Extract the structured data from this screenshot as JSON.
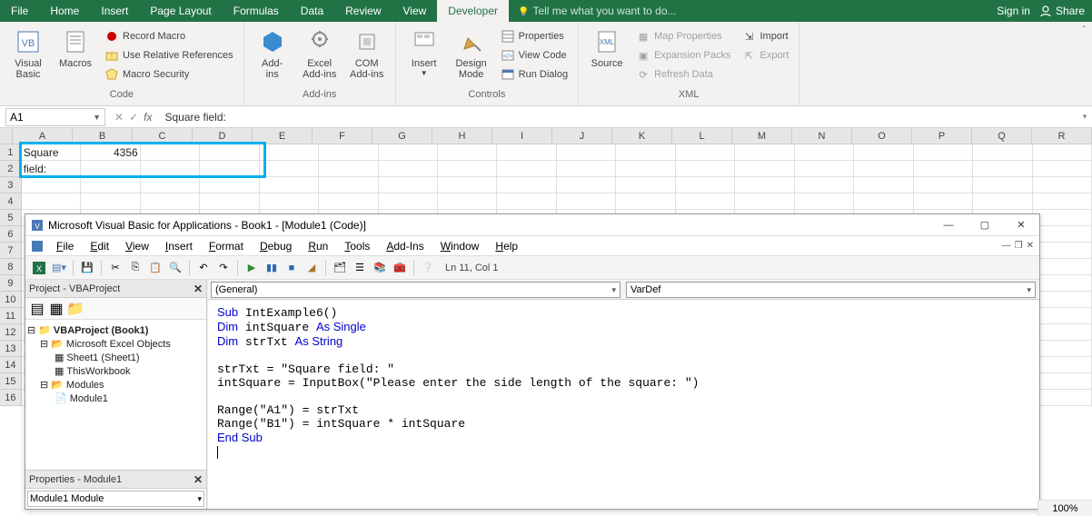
{
  "menubar": {
    "tabs": [
      "File",
      "Home",
      "Insert",
      "Page Layout",
      "Formulas",
      "Data",
      "Review",
      "View",
      "Developer"
    ],
    "active_index": 8,
    "tell_me": "Tell me what you want to do...",
    "sign_in": "Sign in",
    "share": "Share"
  },
  "ribbon": {
    "code": {
      "label": "Code",
      "visual_basic": "Visual\nBasic",
      "macros": "Macros",
      "record_macro": "Record Macro",
      "use_relative": "Use Relative References",
      "macro_security": "Macro Security"
    },
    "addins": {
      "label": "Add-ins",
      "addins": "Add-\nins",
      "excel_addins": "Excel\nAdd-ins",
      "com_addins": "COM\nAdd-ins"
    },
    "controls": {
      "label": "Controls",
      "insert": "Insert",
      "design_mode": "Design\nMode",
      "properties": "Properties",
      "view_code": "View Code",
      "run_dialog": "Run Dialog"
    },
    "xml": {
      "label": "XML",
      "source": "Source",
      "map_properties": "Map Properties",
      "expansion_packs": "Expansion Packs",
      "refresh_data": "Refresh Data",
      "import": "Import",
      "export": "Export"
    }
  },
  "name_box": "A1",
  "formula_bar": "Square field:",
  "columns": [
    "A",
    "B",
    "C",
    "D",
    "E",
    "F",
    "G",
    "H",
    "I",
    "J",
    "K",
    "L",
    "M",
    "N",
    "O",
    "P",
    "Q",
    "R"
  ],
  "rows_visible": [
    "1",
    "2",
    "3",
    "4",
    "5",
    "6",
    "7",
    "8",
    "9",
    "10",
    "11",
    "12",
    "13",
    "14",
    "15",
    "16"
  ],
  "cells": {
    "A1": "Square field:",
    "B1": "4356"
  },
  "vba": {
    "title": "Microsoft Visual Basic for Applications - Book1 - [Module1 (Code)]",
    "menus": [
      "File",
      "Edit",
      "View",
      "Insert",
      "Format",
      "Debug",
      "Run",
      "Tools",
      "Add-Ins",
      "Window",
      "Help"
    ],
    "cursor_pos": "Ln 11, Col 1",
    "project_panel_title": "Project - VBAProject",
    "tree": {
      "root": "VBAProject (Book1)",
      "excel_objects": "Microsoft Excel Objects",
      "sheet1": "Sheet1 (Sheet1)",
      "thisworkbook": "ThisWorkbook",
      "modules": "Modules",
      "module1": "Module1"
    },
    "props_panel_title": "Properties - Module1",
    "props_select": "Module1 Module",
    "dd_left": "(General)",
    "dd_right": "VarDef",
    "code_lines": [
      {
        "t": "plain",
        "tokens": [
          {
            "k": true,
            "s": "Sub"
          },
          {
            "k": false,
            "s": " IntExample6()"
          }
        ]
      },
      {
        "t": "plain",
        "tokens": [
          {
            "k": true,
            "s": "Dim"
          },
          {
            "k": false,
            "s": " intSquare "
          },
          {
            "k": true,
            "s": "As Single"
          }
        ]
      },
      {
        "t": "plain",
        "tokens": [
          {
            "k": true,
            "s": "Dim"
          },
          {
            "k": false,
            "s": " strTxt "
          },
          {
            "k": true,
            "s": "As String"
          }
        ]
      },
      {
        "t": "blank"
      },
      {
        "t": "plain",
        "tokens": [
          {
            "k": false,
            "s": "strTxt = \"Square field: \""
          }
        ]
      },
      {
        "t": "plain",
        "tokens": [
          {
            "k": false,
            "s": "intSquare = InputBox(\"Please enter the side length of the square: \")"
          }
        ]
      },
      {
        "t": "blank"
      },
      {
        "t": "plain",
        "tokens": [
          {
            "k": false,
            "s": "Range(\"A1\") = strTxt"
          }
        ]
      },
      {
        "t": "plain",
        "tokens": [
          {
            "k": false,
            "s": "Range(\"B1\") = intSquare * intSquare"
          }
        ]
      },
      {
        "t": "plain",
        "tokens": [
          {
            "k": true,
            "s": "End Sub"
          }
        ]
      }
    ]
  },
  "zoom": "100%"
}
